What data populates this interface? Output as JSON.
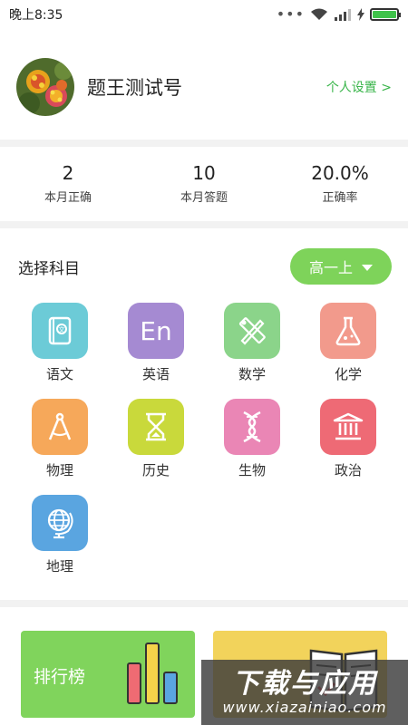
{
  "status_bar": {
    "time": "晚上8:35",
    "dots": "•••"
  },
  "profile": {
    "username": "题王测试号",
    "settings_link": "个人设置 >"
  },
  "stats": [
    {
      "value": "2",
      "label": "本月正确"
    },
    {
      "value": "10",
      "label": "本月答题"
    },
    {
      "value": "20.0%",
      "label": "正确率"
    }
  ],
  "subject_section": {
    "title": "选择科目",
    "grade": "高一上"
  },
  "subjects": [
    {
      "label": "语文",
      "icon": "book-icon",
      "color": "#6ccbd7"
    },
    {
      "label": "英语",
      "icon": "en-icon",
      "icon_text": "En",
      "color": "#a58ad2"
    },
    {
      "label": "数学",
      "icon": "ruler-pencil-icon",
      "color": "#8bd48a"
    },
    {
      "label": "化学",
      "icon": "flask-icon",
      "color": "#f29a8c"
    },
    {
      "label": "物理",
      "icon": "compass-icon",
      "color": "#f6a85a"
    },
    {
      "label": "历史",
      "icon": "hourglass-icon",
      "color": "#c9d93b"
    },
    {
      "label": "生物",
      "icon": "dna-icon",
      "color": "#ea86b5"
    },
    {
      "label": "政治",
      "icon": "government-building-icon",
      "color": "#ee6a75"
    },
    {
      "label": "地理",
      "icon": "globe-icon",
      "color": "#5aa5e0"
    }
  ],
  "cards": {
    "rank_label": "排行榜",
    "rank_color": "#80d45c",
    "book_color": "#f2d35b"
  },
  "watermark": {
    "title": "下载与应用",
    "url": "www.xiazainiao.com"
  }
}
